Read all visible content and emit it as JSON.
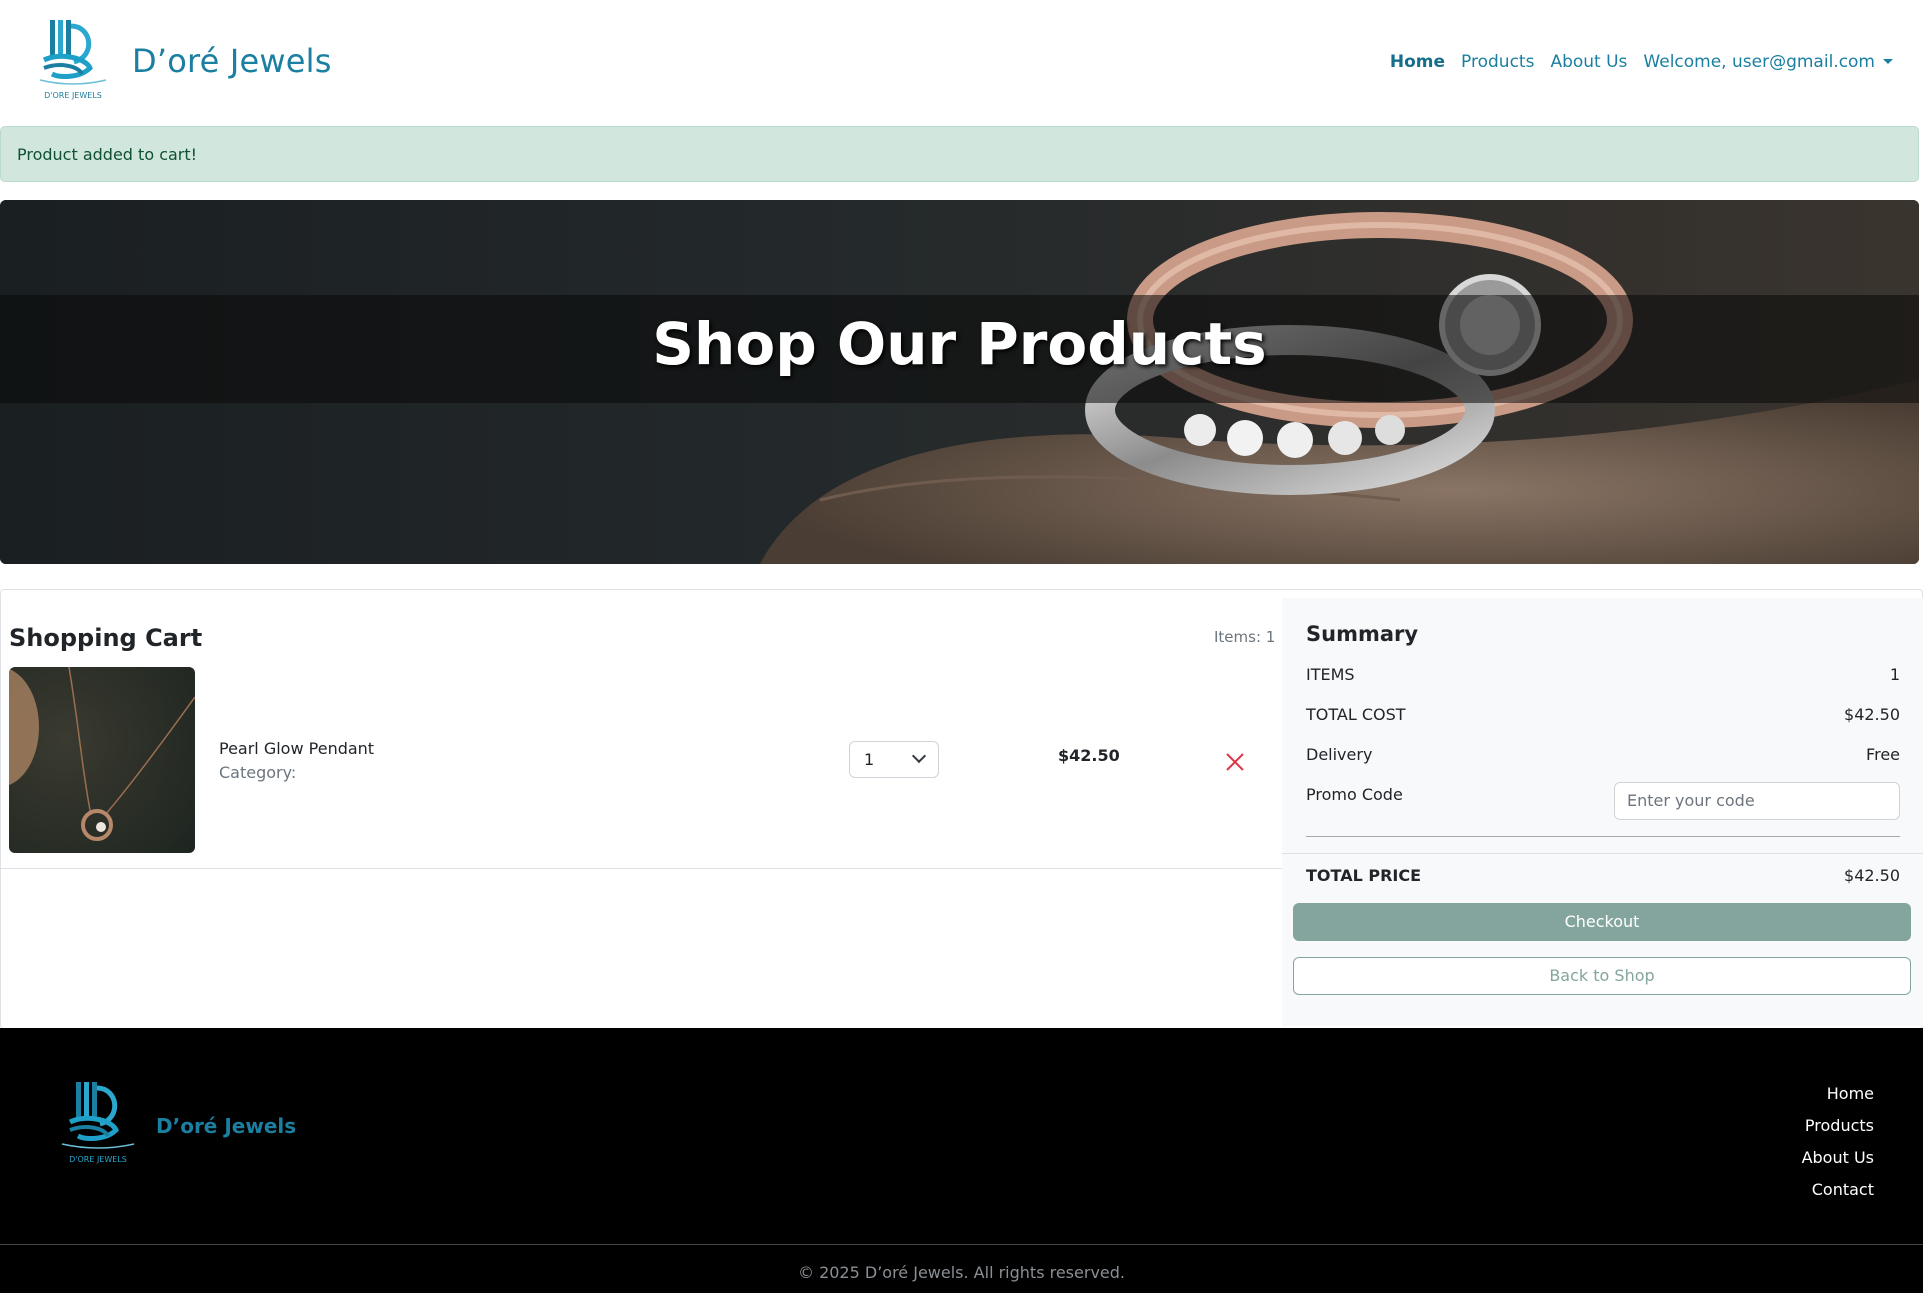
{
  "brand": {
    "name": "D’oré Jewels",
    "logo_text": "D'ORE JEWELS"
  },
  "nav": {
    "home": "Home",
    "products": "Products",
    "about": "About Us",
    "welcome": "Welcome, user@gmail.com"
  },
  "alert": {
    "text": "Product added to cart!"
  },
  "hero": {
    "title": "Shop Our Products"
  },
  "cart": {
    "title": "Shopping Cart",
    "items_label": "Items: 1",
    "item": {
      "name": "Pearl Glow Pendant",
      "category": "Category:",
      "quantity": "1",
      "price": "$42.50"
    }
  },
  "summary": {
    "title": "Summary",
    "items_label": "ITEMS",
    "items_value": "1",
    "total_cost_label": "TOTAL COST",
    "total_cost_value": "$42.50",
    "delivery_label": "Delivery",
    "delivery_value": "Free",
    "promo_label": "Promo Code",
    "promo_placeholder": "Enter your code",
    "total_price_label": "TOTAL PRICE",
    "total_price_value": "$42.50",
    "checkout": "Checkout",
    "back": "Back to Shop"
  },
  "footer": {
    "brand": "D’oré Jewels",
    "links": [
      "Home",
      "Products",
      "About Us",
      "Contact"
    ],
    "copyright": "© 2025 D’oré Jewels. All rights reserved."
  },
  "colors": {
    "accent": "#1a7fa0",
    "button": "#84a59d",
    "alert_bg": "#d1e7dd",
    "footer_bg": "#000000",
    "remove": "#dc3545"
  }
}
